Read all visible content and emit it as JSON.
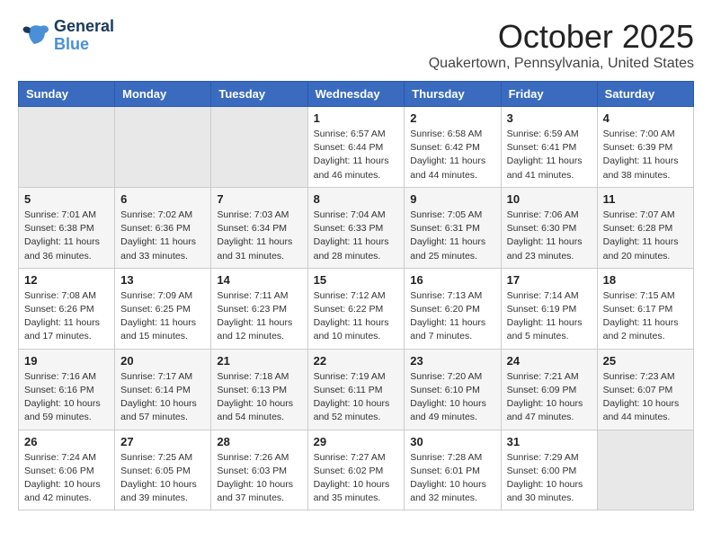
{
  "header": {
    "logo_general": "General",
    "logo_blue": "Blue",
    "month_title": "October 2025",
    "subtitle": "Quakertown, Pennsylvania, United States"
  },
  "days_of_week": [
    "Sunday",
    "Monday",
    "Tuesday",
    "Wednesday",
    "Thursday",
    "Friday",
    "Saturday"
  ],
  "weeks": [
    [
      {
        "day": "",
        "info": ""
      },
      {
        "day": "",
        "info": ""
      },
      {
        "day": "",
        "info": ""
      },
      {
        "day": "1",
        "info": "Sunrise: 6:57 AM\nSunset: 6:44 PM\nDaylight: 11 hours\nand 46 minutes."
      },
      {
        "day": "2",
        "info": "Sunrise: 6:58 AM\nSunset: 6:42 PM\nDaylight: 11 hours\nand 44 minutes."
      },
      {
        "day": "3",
        "info": "Sunrise: 6:59 AM\nSunset: 6:41 PM\nDaylight: 11 hours\nand 41 minutes."
      },
      {
        "day": "4",
        "info": "Sunrise: 7:00 AM\nSunset: 6:39 PM\nDaylight: 11 hours\nand 38 minutes."
      }
    ],
    [
      {
        "day": "5",
        "info": "Sunrise: 7:01 AM\nSunset: 6:38 PM\nDaylight: 11 hours\nand 36 minutes."
      },
      {
        "day": "6",
        "info": "Sunrise: 7:02 AM\nSunset: 6:36 PM\nDaylight: 11 hours\nand 33 minutes."
      },
      {
        "day": "7",
        "info": "Sunrise: 7:03 AM\nSunset: 6:34 PM\nDaylight: 11 hours\nand 31 minutes."
      },
      {
        "day": "8",
        "info": "Sunrise: 7:04 AM\nSunset: 6:33 PM\nDaylight: 11 hours\nand 28 minutes."
      },
      {
        "day": "9",
        "info": "Sunrise: 7:05 AM\nSunset: 6:31 PM\nDaylight: 11 hours\nand 25 minutes."
      },
      {
        "day": "10",
        "info": "Sunrise: 7:06 AM\nSunset: 6:30 PM\nDaylight: 11 hours\nand 23 minutes."
      },
      {
        "day": "11",
        "info": "Sunrise: 7:07 AM\nSunset: 6:28 PM\nDaylight: 11 hours\nand 20 minutes."
      }
    ],
    [
      {
        "day": "12",
        "info": "Sunrise: 7:08 AM\nSunset: 6:26 PM\nDaylight: 11 hours\nand 17 minutes."
      },
      {
        "day": "13",
        "info": "Sunrise: 7:09 AM\nSunset: 6:25 PM\nDaylight: 11 hours\nand 15 minutes."
      },
      {
        "day": "14",
        "info": "Sunrise: 7:11 AM\nSunset: 6:23 PM\nDaylight: 11 hours\nand 12 minutes."
      },
      {
        "day": "15",
        "info": "Sunrise: 7:12 AM\nSunset: 6:22 PM\nDaylight: 11 hours\nand 10 minutes."
      },
      {
        "day": "16",
        "info": "Sunrise: 7:13 AM\nSunset: 6:20 PM\nDaylight: 11 hours\nand 7 minutes."
      },
      {
        "day": "17",
        "info": "Sunrise: 7:14 AM\nSunset: 6:19 PM\nDaylight: 11 hours\nand 5 minutes."
      },
      {
        "day": "18",
        "info": "Sunrise: 7:15 AM\nSunset: 6:17 PM\nDaylight: 11 hours\nand 2 minutes."
      }
    ],
    [
      {
        "day": "19",
        "info": "Sunrise: 7:16 AM\nSunset: 6:16 PM\nDaylight: 10 hours\nand 59 minutes."
      },
      {
        "day": "20",
        "info": "Sunrise: 7:17 AM\nSunset: 6:14 PM\nDaylight: 10 hours\nand 57 minutes."
      },
      {
        "day": "21",
        "info": "Sunrise: 7:18 AM\nSunset: 6:13 PM\nDaylight: 10 hours\nand 54 minutes."
      },
      {
        "day": "22",
        "info": "Sunrise: 7:19 AM\nSunset: 6:11 PM\nDaylight: 10 hours\nand 52 minutes."
      },
      {
        "day": "23",
        "info": "Sunrise: 7:20 AM\nSunset: 6:10 PM\nDaylight: 10 hours\nand 49 minutes."
      },
      {
        "day": "24",
        "info": "Sunrise: 7:21 AM\nSunset: 6:09 PM\nDaylight: 10 hours\nand 47 minutes."
      },
      {
        "day": "25",
        "info": "Sunrise: 7:23 AM\nSunset: 6:07 PM\nDaylight: 10 hours\nand 44 minutes."
      }
    ],
    [
      {
        "day": "26",
        "info": "Sunrise: 7:24 AM\nSunset: 6:06 PM\nDaylight: 10 hours\nand 42 minutes."
      },
      {
        "day": "27",
        "info": "Sunrise: 7:25 AM\nSunset: 6:05 PM\nDaylight: 10 hours\nand 39 minutes."
      },
      {
        "day": "28",
        "info": "Sunrise: 7:26 AM\nSunset: 6:03 PM\nDaylight: 10 hours\nand 37 minutes."
      },
      {
        "day": "29",
        "info": "Sunrise: 7:27 AM\nSunset: 6:02 PM\nDaylight: 10 hours\nand 35 minutes."
      },
      {
        "day": "30",
        "info": "Sunrise: 7:28 AM\nSunset: 6:01 PM\nDaylight: 10 hours\nand 32 minutes."
      },
      {
        "day": "31",
        "info": "Sunrise: 7:29 AM\nSunset: 6:00 PM\nDaylight: 10 hours\nand 30 minutes."
      },
      {
        "day": "",
        "info": ""
      }
    ]
  ]
}
